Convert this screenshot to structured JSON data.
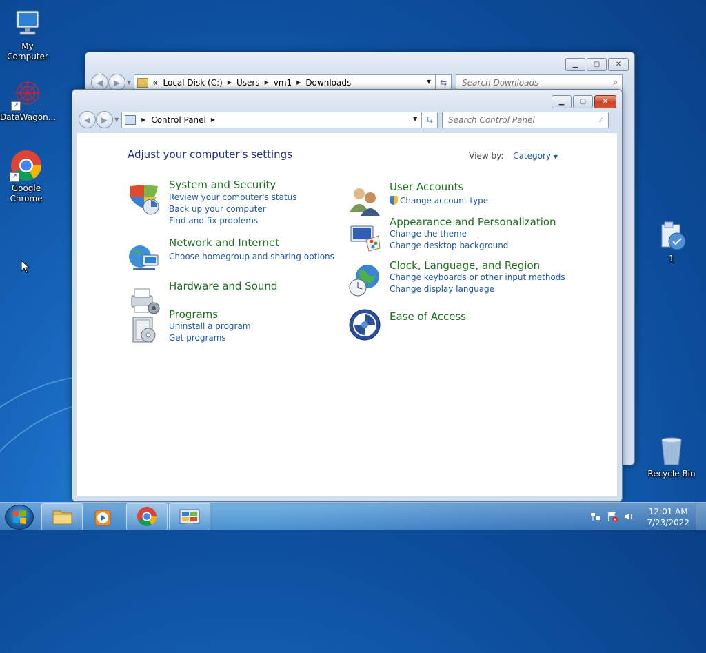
{
  "desktop": {
    "icons": [
      {
        "label": "My Computer"
      },
      {
        "label": "DataWagon..."
      },
      {
        "label": "Google Chrome"
      },
      {
        "label": "1"
      },
      {
        "label": "Recycle Bin"
      }
    ]
  },
  "explorer_window": {
    "breadcrumb": [
      "Local Disk (C:)",
      "Users",
      "vm1",
      "Downloads"
    ],
    "overflow_glyph": "«",
    "search_placeholder": "Search Downloads"
  },
  "control_panel": {
    "breadcrumb": [
      "Control Panel"
    ],
    "search_placeholder": "Search Control Panel",
    "heading": "Adjust your computer's settings",
    "view_by_label": "View by:",
    "view_by_value": "Category",
    "categories": [
      {
        "title": "System and Security",
        "icon": "shield-icon",
        "links": [
          "Review your computer's status",
          "Back up your computer",
          "Find and fix problems"
        ]
      },
      {
        "title": "Network and Internet",
        "icon": "network-icon",
        "links": [
          "Choose homegroup and sharing options"
        ]
      },
      {
        "title": "Hardware and Sound",
        "icon": "printer-icon",
        "links": []
      },
      {
        "title": "Programs",
        "icon": "programs-icon",
        "links": [
          "Uninstall a program",
          "Get programs"
        ]
      },
      {
        "title": "User Accounts",
        "icon": "users-icon",
        "links": [
          "Change account type"
        ]
      },
      {
        "title": "Appearance and Personalization",
        "icon": "monitor-palette-icon",
        "links": [
          "Change the theme",
          "Change desktop background"
        ]
      },
      {
        "title": "Clock, Language, and Region",
        "icon": "clock-globe-icon",
        "links": [
          "Change keyboards or other input methods",
          "Change display language"
        ]
      },
      {
        "title": "Ease of Access",
        "icon": "ease-of-access-icon",
        "links": []
      }
    ]
  },
  "taskbar": {
    "pinned": [
      {
        "name": "windows-explorer",
        "icon": "folder-icon"
      },
      {
        "name": "media-player",
        "icon": "media-player-icon"
      },
      {
        "name": "google-chrome",
        "icon": "chrome-icon"
      },
      {
        "name": "control-panel",
        "icon": "control-panel-icon"
      }
    ],
    "clock_time": "12:01 AM",
    "clock_date": "7/23/2022"
  },
  "colors": {
    "category_title": "#1f6f20",
    "link": "#1e5aa8",
    "heading": "#1e3287"
  }
}
